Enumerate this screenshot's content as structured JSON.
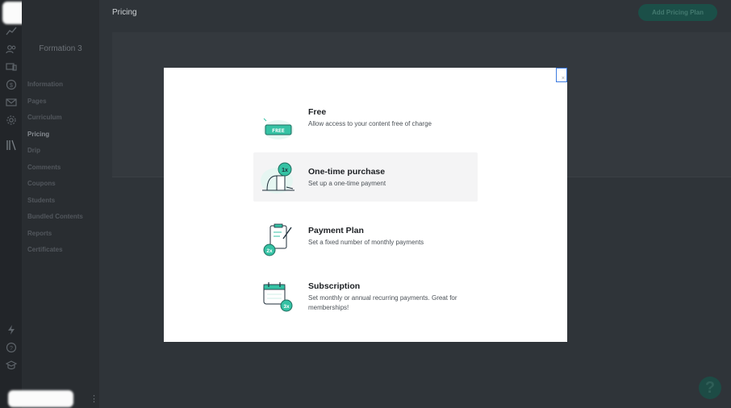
{
  "header": {
    "title": "Pricing",
    "add_button": "Add Pricing Plan"
  },
  "sidebar": {
    "course_name": "Formation 3",
    "items": [
      {
        "label": "Information",
        "active": false
      },
      {
        "label": "Pages",
        "active": false
      },
      {
        "label": "Curriculum",
        "active": false
      },
      {
        "label": "Pricing",
        "active": true
      },
      {
        "label": "Drip",
        "active": false
      },
      {
        "label": "Comments",
        "active": false
      },
      {
        "label": "Coupons",
        "active": false
      },
      {
        "label": "Students",
        "active": false
      },
      {
        "label": "Bundled Contents",
        "active": false
      },
      {
        "label": "Reports",
        "active": false
      },
      {
        "label": "Certificates",
        "active": false
      }
    ]
  },
  "rail_icons": [
    "analytics-icon",
    "users-icon",
    "sites-icon",
    "sales-icon",
    "email-icon",
    "settings-icon",
    "library-icon",
    "lightning-icon",
    "help-circle-icon",
    "graduation-icon"
  ],
  "modal": {
    "close_glyph": "×",
    "options": [
      {
        "title": "Free",
        "desc": "Allow access to your content free of charge",
        "badge": "FREE"
      },
      {
        "title": "One-time purchase",
        "desc": "Set up a one-time payment",
        "badge": "1x"
      },
      {
        "title": "Payment Plan",
        "desc": "Set a fixed number of monthly payments",
        "badge": "2x"
      },
      {
        "title": "Subscription",
        "desc": "Set monthly or annual recurring payments. Great for memberships!",
        "badge": "3x"
      }
    ]
  },
  "help": {
    "glyph": "?"
  },
  "colors": {
    "accent": "#35c2a4",
    "modal_bg": "#ffffff",
    "overlay": "#2f3439",
    "sidebar": "#292d31"
  }
}
